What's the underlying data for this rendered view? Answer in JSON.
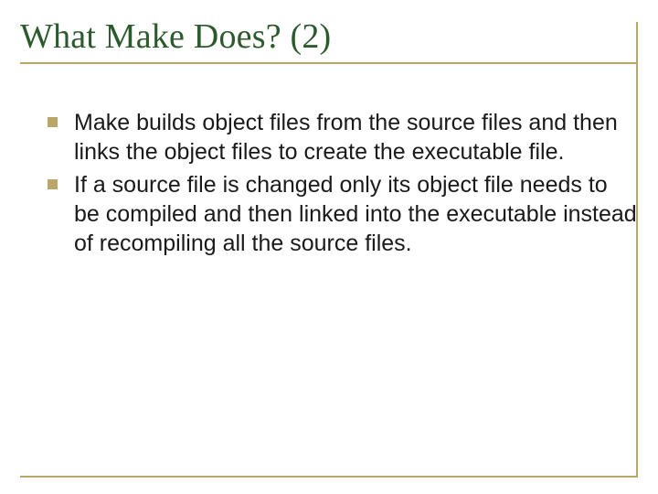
{
  "slide": {
    "title": "What Make Does? (2)",
    "bullets": [
      "Make builds object files from the source files and then links the object files to create the executable file.",
      "If a source file is changed only its object file needs to be compiled and then linked into the executable instead of recompiling all the source files."
    ]
  }
}
